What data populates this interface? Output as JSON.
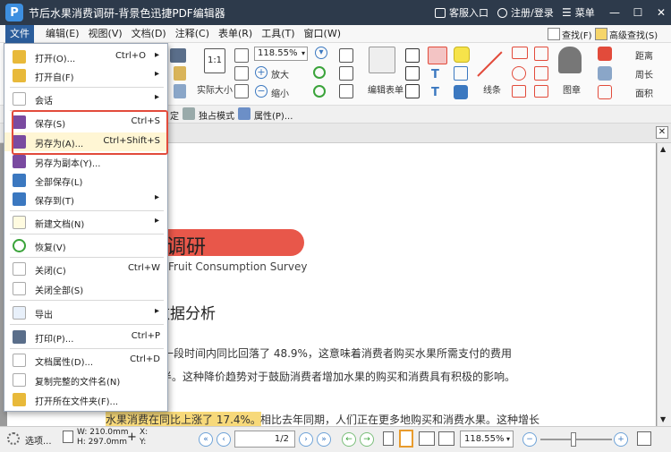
{
  "app": {
    "title": "节后水果消费调研-背景色迅捷PDF编辑器",
    "logo": "P"
  },
  "titlebar": {
    "support": "客服入口",
    "login": "注册/登录",
    "menu": "菜单"
  },
  "menubar": {
    "items": [
      "文件",
      "编辑(E)",
      "视图(V)",
      "文档(D)",
      "注释(C)",
      "表单(R)",
      "工具(T)",
      "窗口(W)"
    ]
  },
  "ribbon": {
    "zoom_value": "118.55%",
    "actual_size": "实际大小",
    "zoom_in": "放大",
    "zoom_out": "缩小",
    "edit_form": "编辑表单",
    "line": "线条",
    "stamp": "图章",
    "find": "查找(F)",
    "advanced_find": "高级查找(S)",
    "distance": "距离",
    "perimeter": "周长",
    "area": "面积"
  },
  "subbar": {
    "exclusive_mode": "独占模式",
    "properties": "属性(P)...",
    "partial": "定"
  },
  "filemenu": {
    "items": [
      {
        "label": "打开(O)...",
        "shortcut": "Ctrl+O",
        "arrow": "▸"
      },
      {
        "label": "打开自(F)",
        "shortcut": "",
        "arrow": "▸"
      },
      {
        "label": "会话",
        "shortcut": "",
        "arrow": "▸"
      },
      {
        "label": "保存(S)",
        "shortcut": "Ctrl+S",
        "arrow": ""
      },
      {
        "label": "另存为(A)...",
        "shortcut": "Ctrl+Shift+S",
        "arrow": ""
      },
      {
        "label": "另存为副本(Y)...",
        "shortcut": "",
        "arrow": ""
      },
      {
        "label": "全部保存(L)",
        "shortcut": "",
        "arrow": ""
      },
      {
        "label": "保存到(T)",
        "shortcut": "",
        "arrow": "▸"
      },
      {
        "label": "新建文档(N)",
        "shortcut": "",
        "arrow": "▸"
      },
      {
        "label": "恢复(V)",
        "shortcut": "",
        "arrow": ""
      },
      {
        "label": "关闭(C)",
        "shortcut": "Ctrl+W",
        "arrow": ""
      },
      {
        "label": "关闭全部(S)",
        "shortcut": "",
        "arrow": ""
      },
      {
        "label": "导出",
        "shortcut": "",
        "arrow": "▸"
      },
      {
        "label": "打印(P)...",
        "shortcut": "Ctrl+P",
        "arrow": ""
      },
      {
        "label": "文档属性(D)...",
        "shortcut": "Ctrl+D",
        "arrow": ""
      },
      {
        "label": "复制完整的文件名(N)",
        "shortcut": "",
        "arrow": ""
      },
      {
        "label": "打开所在文件夹(F)...",
        "shortcut": "",
        "arrow": ""
      }
    ]
  },
  "document": {
    "title": "水果消费调研",
    "subtitle": "Fruit Consumption Survey",
    "heading": "数据分析",
    "para1_line1": "最近一段时间内同比回落了 48.9%，这意味着消费者购买水果所需支付的费用",
    "para1_line2": "半。这种降价趋势对于鼓励消费者增加水果的购买和消费具有积极的影响。",
    "highlight": "水果消费在同比上涨了 17.4%。",
    "para2_rest": "相比去年同期，人们正在更多地购买和消费水果。这种增长"
  },
  "statusbar": {
    "options": "选项...",
    "width": "W: 210.0mm",
    "height": "H: 297.0mm",
    "x": "X:",
    "y": "Y:",
    "page_current": "1",
    "page_total": "/2",
    "zoom": "118.55%"
  },
  "colors": {
    "titlebar": "#2d3a4b",
    "accent": "#2b5d9b",
    "title_banner": "#e8574a",
    "highlight": "#f7d97a",
    "red_outline": "#e24b3b"
  }
}
